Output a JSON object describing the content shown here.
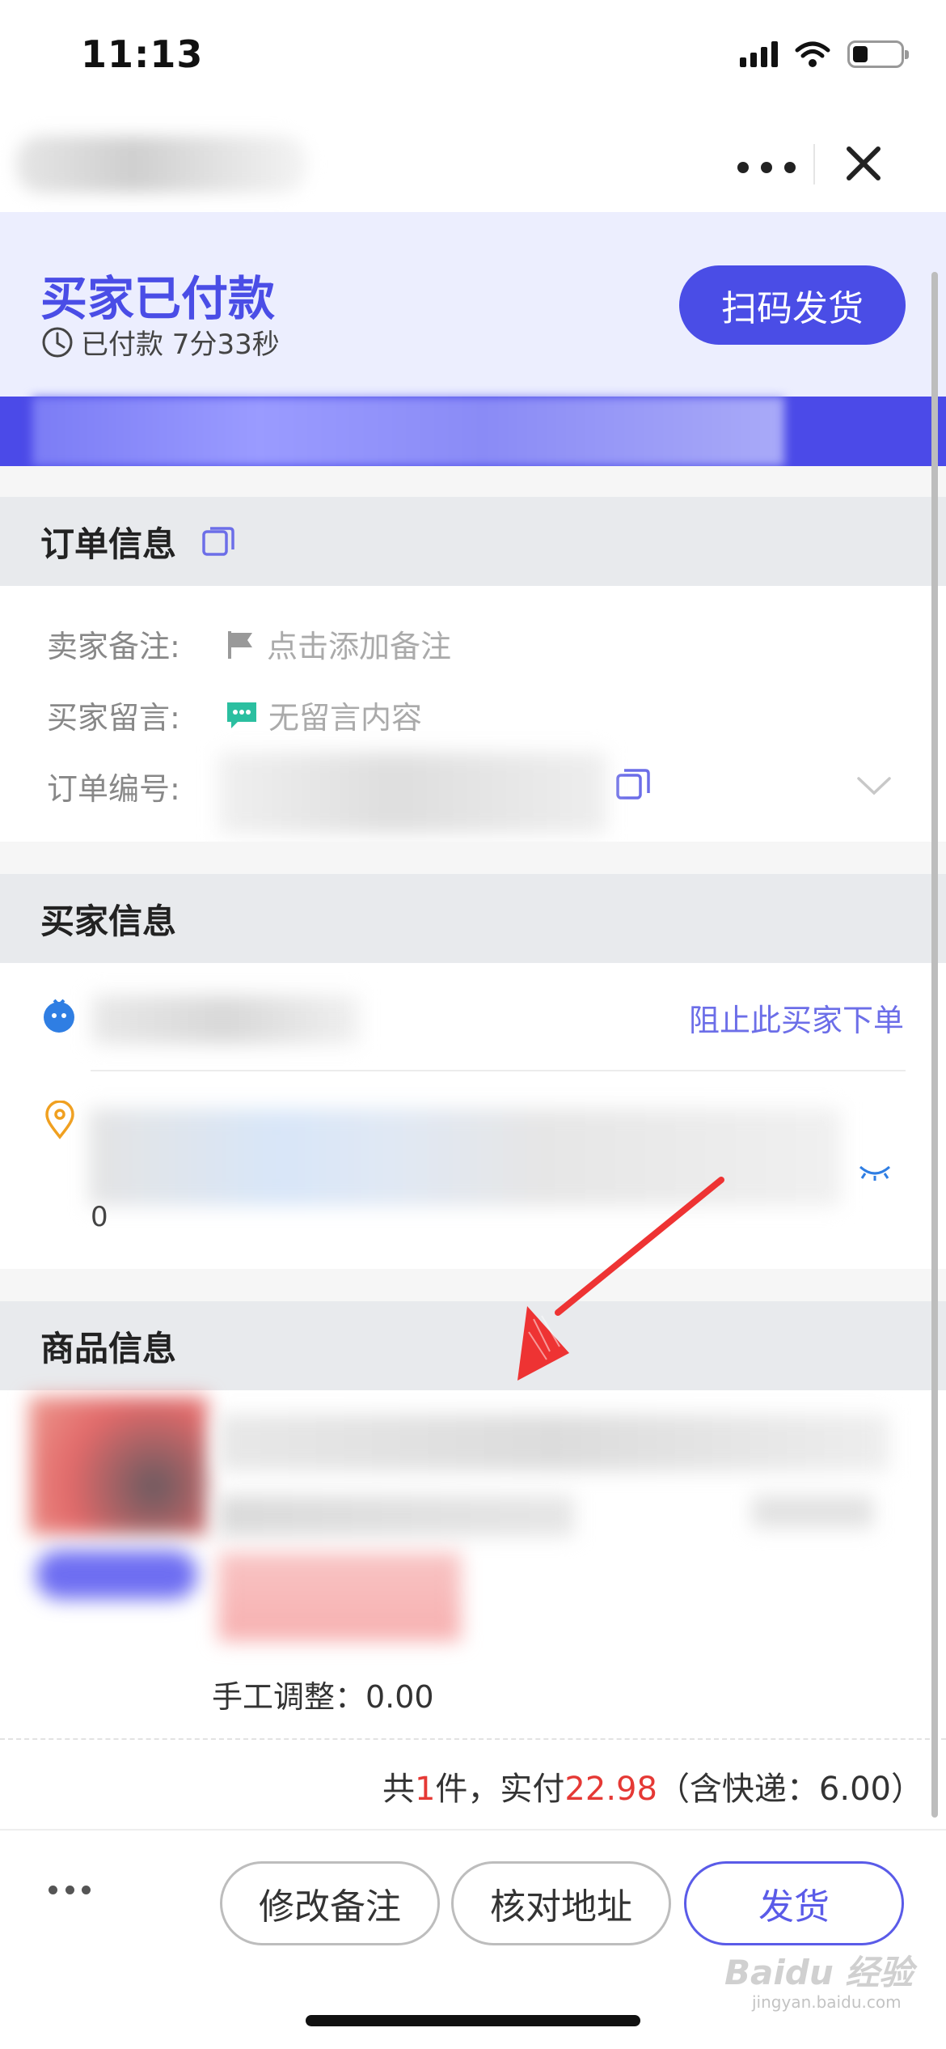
{
  "status_bar": {
    "time": "11:13"
  },
  "header": {
    "status_title": "买家已付款",
    "paid_status": "已付款 7分33秒",
    "scan_button": "扫码发货"
  },
  "order_info": {
    "section_title": "订单信息",
    "seller_note_label": "卖家备注:",
    "seller_note_value": "点击添加备注",
    "buyer_message_label": "买家留言:",
    "buyer_message_value": "无留言内容",
    "order_number_label": "订单编号:"
  },
  "buyer_info": {
    "section_title": "买家信息",
    "block_buyer_link": "阻止此买家下单",
    "address_tail": "0"
  },
  "product_info": {
    "section_title": "商品信息",
    "manual_adjust": "手工调整：0.00",
    "summary_prefix": "共",
    "summary_count": "1",
    "summary_mid": "件，实付",
    "summary_amount": "22.98",
    "summary_suffix": "（含快递：6.00）"
  },
  "footer": {
    "more_icon": "more-dots-icon",
    "edit_note_button": "修改备注",
    "check_address_button": "核对地址",
    "ship_button": "发货"
  },
  "watermark": {
    "text": "Baidu 经验",
    "sub": "jingyan.baidu.com"
  },
  "colors": {
    "accent": "#4a4de6",
    "price_red": "#e53935",
    "header_bg": "#eceefe",
    "section_header_bg": "#e8eaed",
    "arrow_red": "#ee3333"
  }
}
